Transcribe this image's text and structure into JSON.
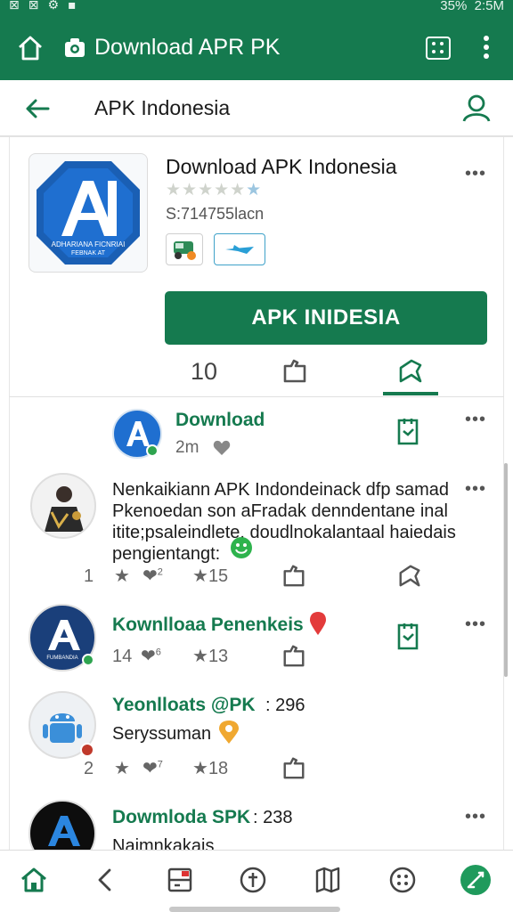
{
  "status_bar": {
    "battery": "35%",
    "time": "2:5M"
  },
  "app_bar": {
    "title": "Download APR PK"
  },
  "sub_bar": {
    "title": "APK Indonesia"
  },
  "app": {
    "name": "Download APK Indonesia",
    "rating_stars": 5,
    "size": "S:714755lacn",
    "install_label": "APK INIDESIA",
    "icon_caption_1": "ADHARIANA FICNRIAI",
    "icon_caption_2": "FEBNAK AT",
    "more": "•••"
  },
  "tabs": {
    "count": "10"
  },
  "feed": [
    {
      "name": "Download",
      "time": "2m",
      "more": "•••"
    },
    {
      "text": "Nenkaikiann APK Indondeinack dfp samad Pkenoedan son aFradak denndentane inal itite;psaleindlete, doudlnokalantaal haiedais pengientangt:",
      "more": "•••",
      "stat_comments": "1",
      "stat_likes": "2",
      "stat_stars": "15"
    },
    {
      "name": "Kownlloaa Penenkeis",
      "avatar_caption": "FUMBANDIA",
      "more": "•••",
      "stat_comments": "14",
      "stat_likes": "6",
      "stat_stars": "13"
    },
    {
      "name": "Yeonlloats @PK",
      "count": ": 296",
      "text": "Seryssuman",
      "stat_comments": "2",
      "stat_likes": "7",
      "stat_stars": "18"
    },
    {
      "name": "Dowmloda SPK",
      "count": ": 238",
      "text": "Naimnkakais",
      "more": "•••"
    }
  ],
  "colors": {
    "brand_green": "#157a4f",
    "text_dark": "#1b1b1b",
    "muted": "#666666"
  }
}
